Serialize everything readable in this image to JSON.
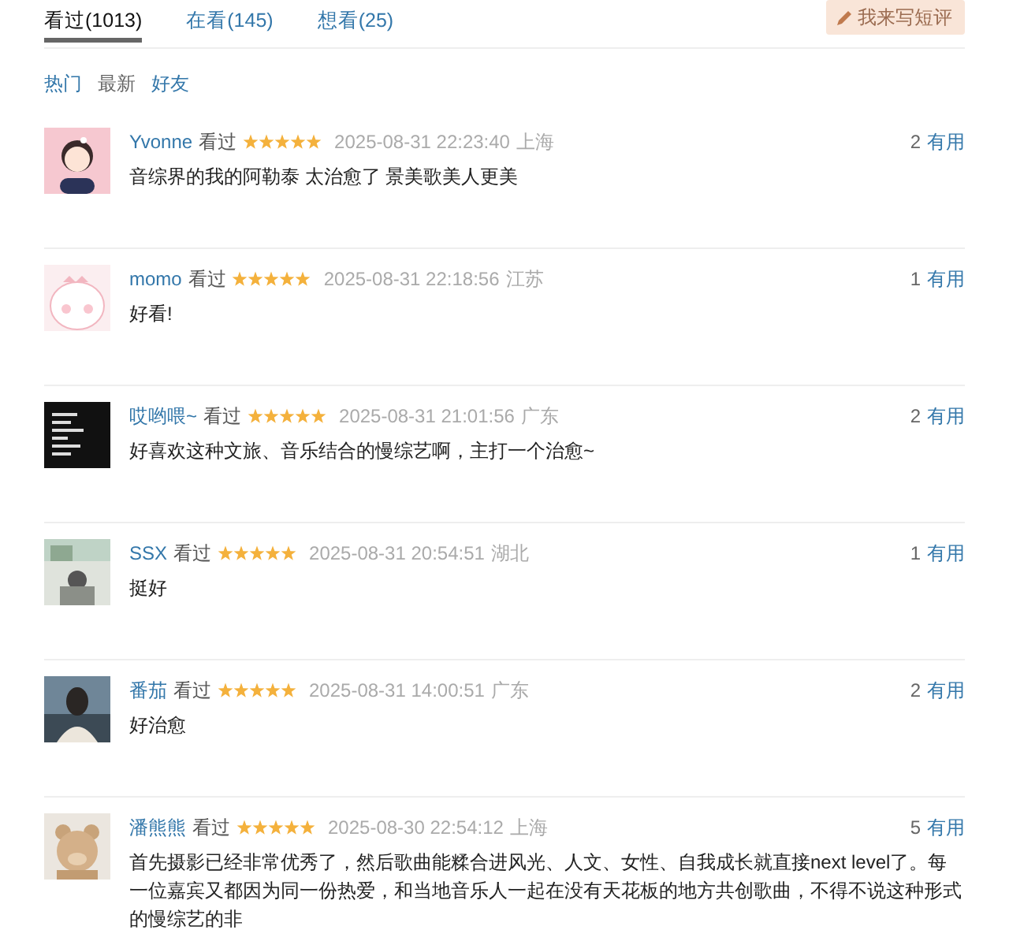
{
  "tabs": [
    {
      "label": "看过(1013)",
      "selected": true
    },
    {
      "label": "在看(145)",
      "selected": false
    },
    {
      "label": "想看(25)",
      "selected": false
    }
  ],
  "write_button": {
    "label": "我来写短评"
  },
  "sort_options": [
    {
      "label": "热门",
      "selected": false
    },
    {
      "label": "最新",
      "selected": true
    },
    {
      "label": "好友",
      "selected": false
    }
  ],
  "comments": [
    {
      "user": "Yvonne",
      "status": "看过",
      "stars": 5,
      "time": "2025-08-31 22:23:40",
      "location": "上海",
      "votes": "2",
      "vote_label": "有用",
      "text": "音综界的我的阿勒泰 太治愈了 景美歌美人更美"
    },
    {
      "user": "momo",
      "status": "看过",
      "stars": 5,
      "time": "2025-08-31 22:18:56",
      "location": "江苏",
      "votes": "1",
      "vote_label": "有用",
      "text": "好看!"
    },
    {
      "user": "哎哟喂~",
      "status": "看过",
      "stars": 5,
      "time": "2025-08-31 21:01:56",
      "location": "广东",
      "votes": "2",
      "vote_label": "有用",
      "text": "好喜欢这种文旅、音乐结合的慢综艺啊，主打一个治愈~"
    },
    {
      "user": "SSX",
      "status": "看过",
      "stars": 5,
      "time": "2025-08-31 20:54:51",
      "location": "湖北",
      "votes": "1",
      "vote_label": "有用",
      "text": "挺好"
    },
    {
      "user": "番茄",
      "status": "看过",
      "stars": 5,
      "time": "2025-08-31 14:00:51",
      "location": "广东",
      "votes": "2",
      "vote_label": "有用",
      "text": "好治愈"
    },
    {
      "user": "潘熊熊",
      "status": "看过",
      "stars": 5,
      "time": "2025-08-30 22:54:12",
      "location": "上海",
      "votes": "5",
      "vote_label": "有用",
      "text": "首先摄影已经非常优秀了，然后歌曲能糅合进风光、人文、女性、自我成长就直接next level了。每一位嘉宾又都因为同一份热爱，和当地音乐人一起在没有天花板的地方共创歌曲，不得不说这种形式的慢综艺的非"
    }
  ]
}
